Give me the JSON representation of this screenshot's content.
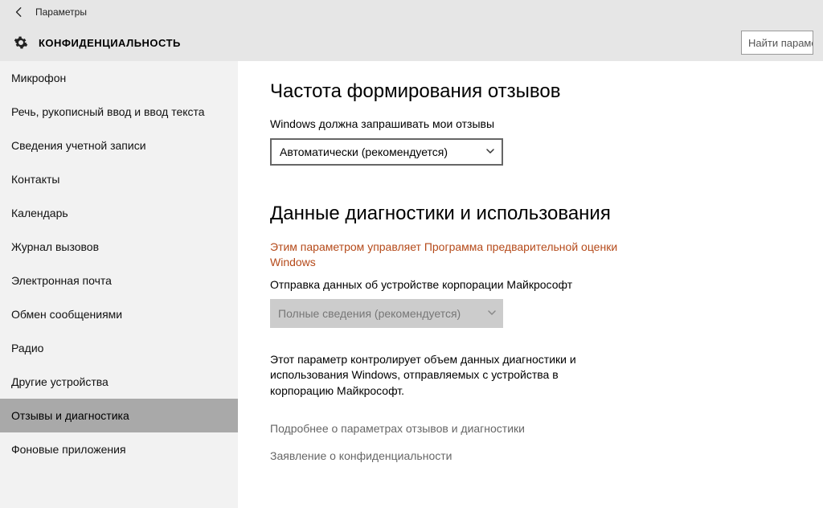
{
  "window": {
    "app_title": "Параметры",
    "page_heading": "КОНФИДЕНЦИАЛЬНОСТЬ",
    "search_placeholder": "Найти параме"
  },
  "sidebar": {
    "items": [
      {
        "label": "Микрофон"
      },
      {
        "label": "Речь, рукописный ввод и ввод текста"
      },
      {
        "label": "Сведения учетной записи"
      },
      {
        "label": "Контакты"
      },
      {
        "label": "Календарь"
      },
      {
        "label": "Журнал вызовов"
      },
      {
        "label": "Электронная почта"
      },
      {
        "label": "Обмен сообщениями"
      },
      {
        "label": "Радио"
      },
      {
        "label": "Другие устройства"
      },
      {
        "label": "Отзывы и диагностика",
        "selected": true
      },
      {
        "label": "Фоновые приложения"
      }
    ]
  },
  "main": {
    "feedback": {
      "heading": "Частота формирования отзывов",
      "label": "Windows должна запрашивать мои отзывы",
      "dropdown_value": "Автоматически (рекомендуется)"
    },
    "diagnostics": {
      "heading": "Данные диагностики и использования",
      "managed_notice": "Этим параметром управляет Программа предварительной оценки Windows",
      "label": "Отправка данных об устройстве корпорации Майкрософт",
      "dropdown_value": "Полные сведения (рекомендуется)",
      "description": "Этот параметр контролирует объем данных диагностики и использования Windows, отправляемых с устройства в корпорацию Майкрософт."
    },
    "links": {
      "learn_more": "Подробнее о параметрах отзывов и диагностики",
      "privacy": "Заявление о конфиденциальности"
    }
  }
}
